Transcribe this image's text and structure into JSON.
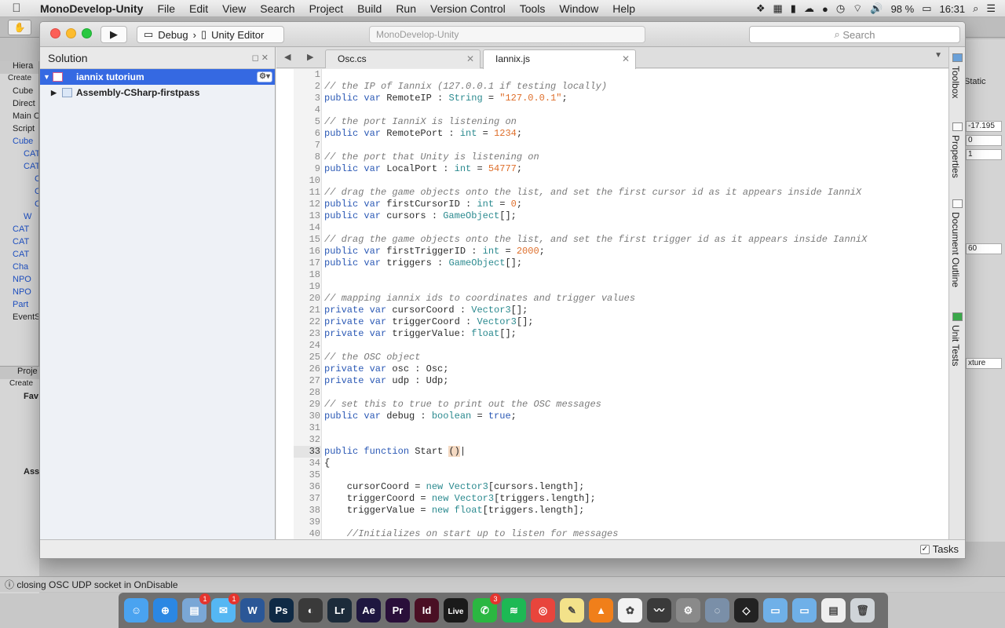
{
  "menubar": {
    "app": "MonoDevelop-Unity",
    "items": [
      "File",
      "Edit",
      "View",
      "Search",
      "Project",
      "Build",
      "Run",
      "Version Control",
      "Tools",
      "Window",
      "Help"
    ],
    "battery": "98 %",
    "time": "16:31"
  },
  "window": {
    "title": "MonoDevelop-Unity",
    "config": "Debug",
    "target": "Unity Editor",
    "search_placeholder": "Search"
  },
  "solution": {
    "header": "Solution",
    "items": [
      {
        "label": "iannix tutorium",
        "selected": true
      },
      {
        "label": "Assembly-CSharp-firstpass",
        "selected": false
      }
    ]
  },
  "tabs": [
    {
      "label": "Osc.cs",
      "active": false
    },
    {
      "label": "Iannix.js",
      "active": true
    }
  ],
  "code": [
    [],
    [
      [
        "c",
        "// the IP of Iannix (127.0.0.1 if testing locally)"
      ]
    ],
    [
      [
        "k",
        "public var "
      ],
      [
        "p",
        "RemoteIP : "
      ],
      [
        "t",
        "String"
      ],
      [
        "p",
        " = "
      ],
      [
        "s",
        "\"127.0.0.1\""
      ],
      [
        "p",
        ";"
      ]
    ],
    [],
    [
      [
        "c",
        "// the port IanniX is listening on"
      ]
    ],
    [
      [
        "k",
        "public var "
      ],
      [
        "p",
        "RemotePort : "
      ],
      [
        "t",
        "int"
      ],
      [
        "p",
        " = "
      ],
      [
        "n",
        "1234"
      ],
      [
        "p",
        ";"
      ]
    ],
    [],
    [
      [
        "c",
        "// the port that Unity is listening on"
      ]
    ],
    [
      [
        "k",
        "public var "
      ],
      [
        "p",
        "LocalPort : "
      ],
      [
        "t",
        "int"
      ],
      [
        "p",
        " = "
      ],
      [
        "n",
        "54777"
      ],
      [
        "p",
        ";"
      ]
    ],
    [],
    [
      [
        "c",
        "// drag the game objects onto the list, and set the first cursor id as it appears inside IanniX"
      ]
    ],
    [
      [
        "k",
        "public var "
      ],
      [
        "p",
        "firstCursorID : "
      ],
      [
        "t",
        "int"
      ],
      [
        "p",
        " = "
      ],
      [
        "n",
        "0"
      ],
      [
        "p",
        ";"
      ]
    ],
    [
      [
        "k",
        "public var "
      ],
      [
        "p",
        "cursors : "
      ],
      [
        "t",
        "GameObject"
      ],
      [
        "p",
        "[];"
      ]
    ],
    [],
    [
      [
        "c",
        "// drag the game objects onto the list, and set the first trigger id as it appears inside IanniX"
      ]
    ],
    [
      [
        "k",
        "public var "
      ],
      [
        "p",
        "firstTriggerID : "
      ],
      [
        "t",
        "int"
      ],
      [
        "p",
        " = "
      ],
      [
        "n",
        "2000"
      ],
      [
        "p",
        ";"
      ]
    ],
    [
      [
        "k",
        "public var "
      ],
      [
        "p",
        "triggers : "
      ],
      [
        "t",
        "GameObject"
      ],
      [
        "p",
        "[];"
      ]
    ],
    [],
    [],
    [
      [
        "c",
        "// mapping iannix ids to coordinates and trigger values"
      ]
    ],
    [
      [
        "k",
        "private var "
      ],
      [
        "p",
        "cursorCoord : "
      ],
      [
        "t",
        "Vector3"
      ],
      [
        "p",
        "[];"
      ]
    ],
    [
      [
        "k",
        "private var "
      ],
      [
        "p",
        "triggerCoord : "
      ],
      [
        "t",
        "Vector3"
      ],
      [
        "p",
        "[];"
      ]
    ],
    [
      [
        "k",
        "private var "
      ],
      [
        "p",
        "triggerValue: "
      ],
      [
        "t",
        "float"
      ],
      [
        "p",
        "[];"
      ]
    ],
    [],
    [
      [
        "c",
        "// the OSC object"
      ]
    ],
    [
      [
        "k",
        "private var "
      ],
      [
        "p",
        "osc : Osc;"
      ]
    ],
    [
      [
        "k",
        "private var "
      ],
      [
        "p",
        "udp : Udp;"
      ]
    ],
    [],
    [
      [
        "c",
        "// set this to true to print out the OSC messages"
      ]
    ],
    [
      [
        "k",
        "public var "
      ],
      [
        "p",
        "debug : "
      ],
      [
        "t",
        "boolean"
      ],
      [
        "p",
        " = "
      ],
      [
        "k",
        "true"
      ],
      [
        "p",
        ";"
      ]
    ],
    [],
    [],
    [
      [
        "k",
        "public function "
      ],
      [
        "p",
        "Start "
      ],
      [
        "b",
        "("
      ],
      [
        "b",
        ")"
      ],
      [
        "p",
        "|"
      ]
    ],
    [
      [
        "p",
        "{"
      ]
    ],
    [],
    [
      [
        "p",
        "    cursorCoord = "
      ],
      [
        "t",
        "new "
      ],
      [
        "t",
        "Vector3"
      ],
      [
        "p",
        "[cursors.length];"
      ]
    ],
    [
      [
        "p",
        "    triggerCoord = "
      ],
      [
        "t",
        "new "
      ],
      [
        "t",
        "Vector3"
      ],
      [
        "p",
        "[triggers.length];"
      ]
    ],
    [
      [
        "p",
        "    triggerValue = "
      ],
      [
        "t",
        "new "
      ],
      [
        "t",
        "float"
      ],
      [
        "p",
        "[triggers.length];"
      ]
    ],
    [],
    [
      [
        "c",
        "    //Initializes on start up to listen for messages"
      ]
    ]
  ],
  "current_line": 33,
  "right_dock": [
    "Toolbox",
    "Properties",
    "Document Outline",
    "Unit Tests"
  ],
  "tasks_label": "Tasks",
  "status_message": "closing OSC UDP socket in OnDisable",
  "unity_bg": {
    "hierarchy_tab": "Hiera",
    "create": "Create",
    "hierarchy_rows": [
      "Cube",
      "Direct",
      "Main C",
      "Script",
      "Cube",
      "CAT",
      "CAT",
      "C",
      "C",
      "C",
      "W",
      "CAT",
      "CAT",
      "CAT",
      "Cha",
      "NPO",
      "NPO",
      "Part",
      "EventS"
    ],
    "project_tab": "Proje",
    "favorites": "Fav",
    "assets": "Ass",
    "inspector_static": "Static",
    "inspector_vals": [
      "-17.195",
      "0",
      "1",
      "60",
      "xture"
    ]
  },
  "dock_apps": [
    {
      "name": "Finder",
      "color": "#4aa3f0",
      "glyph": "☺",
      "badge": ""
    },
    {
      "name": "Safari",
      "color": "#2b87e3",
      "glyph": "⊕",
      "badge": ""
    },
    {
      "name": "Preview",
      "color": "#7aa7d6",
      "glyph": "▤",
      "badge": "1"
    },
    {
      "name": "Messages",
      "color": "#55b7f3",
      "glyph": "✉",
      "badge": "1"
    },
    {
      "name": "Word",
      "color": "#2b5797",
      "glyph": "W",
      "badge": ""
    },
    {
      "name": "Photoshop",
      "color": "#0f2a45",
      "glyph": "Ps",
      "badge": ""
    },
    {
      "name": "Unity Hub",
      "color": "#3a3a3a",
      "glyph": "◐",
      "badge": ""
    },
    {
      "name": "Lightroom",
      "color": "#1c2b3a",
      "glyph": "Lr",
      "badge": ""
    },
    {
      "name": "After Effects",
      "color": "#1f1740",
      "glyph": "Ae",
      "badge": ""
    },
    {
      "name": "Premiere",
      "color": "#2a0f3a",
      "glyph": "Pr",
      "badge": ""
    },
    {
      "name": "InDesign",
      "color": "#4a0f24",
      "glyph": "Id",
      "badge": ""
    },
    {
      "name": "Ableton Live",
      "color": "#1a1a1a",
      "glyph": "Live",
      "badge": ""
    },
    {
      "name": "WhatsApp",
      "color": "#2bb741",
      "glyph": "✆",
      "badge": "3"
    },
    {
      "name": "Spotify",
      "color": "#1db954",
      "glyph": "≋",
      "badge": ""
    },
    {
      "name": "Chrome",
      "color": "#e8453c",
      "glyph": "◎",
      "badge": ""
    },
    {
      "name": "Notes",
      "color": "#f3e28a",
      "glyph": "✎",
      "badge": ""
    },
    {
      "name": "VLC",
      "color": "#f07f1a",
      "glyph": "▲",
      "badge": ""
    },
    {
      "name": "Photos",
      "color": "#f2f2f2",
      "glyph": "✿",
      "badge": ""
    },
    {
      "name": "Pages",
      "color": "#3a3a3a",
      "glyph": "〰",
      "badge": ""
    },
    {
      "name": "System Preferences",
      "color": "#8a8a8a",
      "glyph": "⚙",
      "badge": ""
    },
    {
      "name": "Network Radar",
      "color": "#7a8fa8",
      "glyph": "◌",
      "badge": ""
    },
    {
      "name": "Unity",
      "color": "#222222",
      "glyph": "◇",
      "badge": ""
    },
    {
      "name": "Folder",
      "color": "#6fb0e8",
      "glyph": "▭",
      "badge": ""
    },
    {
      "name": "Downloads",
      "color": "#6fb0e8",
      "glyph": "▭",
      "badge": ""
    },
    {
      "name": "Document",
      "color": "#eeeeee",
      "glyph": "▤",
      "badge": ""
    },
    {
      "name": "Trash",
      "color": "#cfd4d8",
      "glyph": "🗑",
      "badge": ""
    }
  ]
}
